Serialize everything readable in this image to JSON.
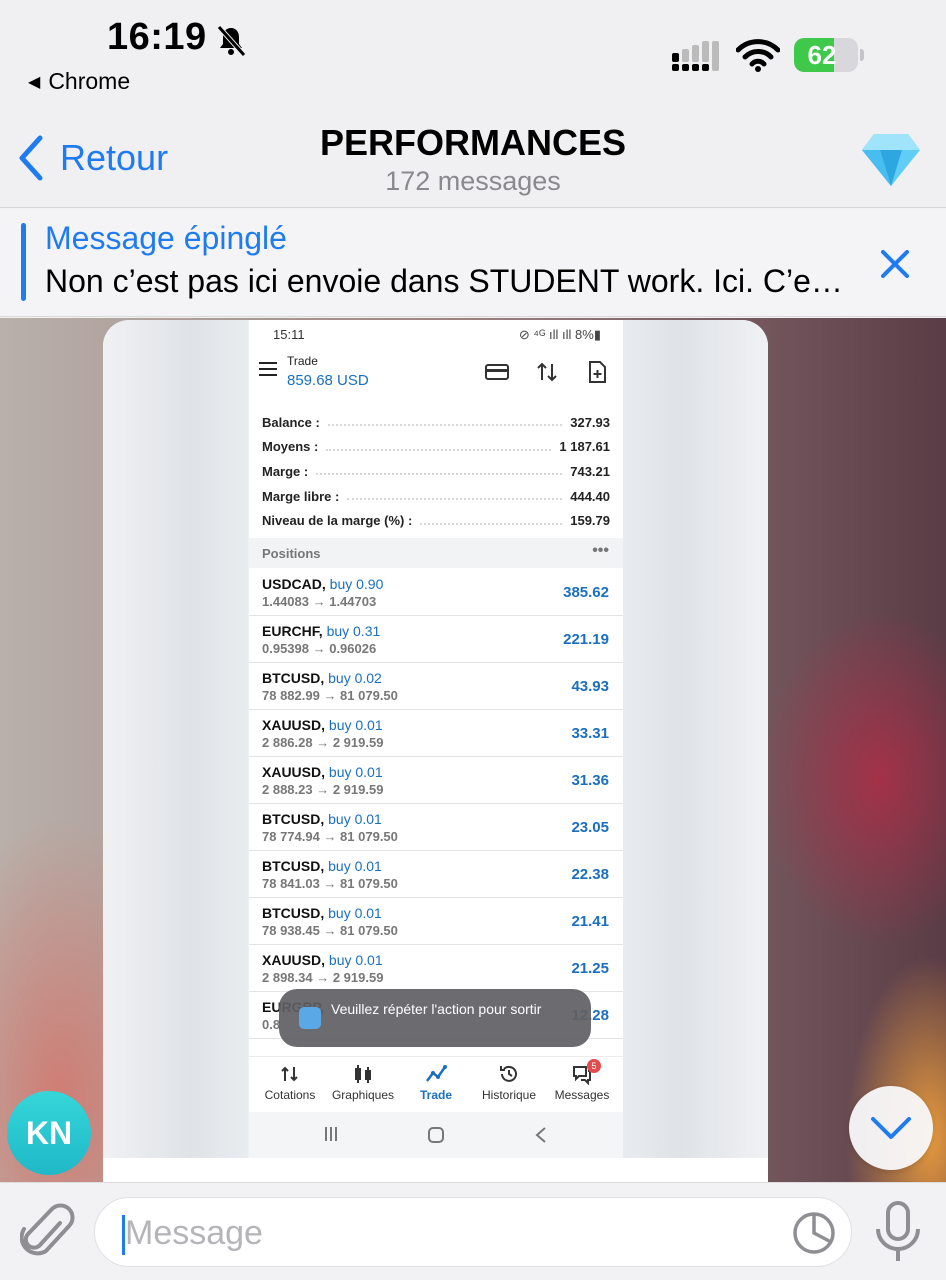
{
  "status_bar": {
    "time": "16:19",
    "back_app": "Chrome",
    "battery": "62",
    "battery_level": 0.62,
    "icons": [
      "bell-slash-icon",
      "signal-icon",
      "wifi-icon",
      "battery-charging-icon"
    ]
  },
  "header": {
    "back_label": "Retour",
    "title": "PERFORMANCES",
    "subtitle": "172 messages",
    "icons": [
      "chevron-left-icon",
      "diamond-icon"
    ]
  },
  "pinned": {
    "label": "Message épinglé",
    "text": "Non c’est pas ici envoie dans STUDENT work. Ici. C’e…"
  },
  "screenshot": {
    "status": {
      "time": "15:11",
      "right": "⊘ ⁴ᴳ ıll ıll 8%▮"
    },
    "header": {
      "title": "Trade",
      "balance": "859.68 USD"
    },
    "account": [
      {
        "label": "Balance :",
        "value": "327.93"
      },
      {
        "label": "Moyens :",
        "value": "1 187.61"
      },
      {
        "label": "Marge :",
        "value": "743.21"
      },
      {
        "label": "Marge libre :",
        "value": "444.40"
      },
      {
        "label": "Niveau de la marge (%) :",
        "value": "159.79"
      }
    ],
    "positions_title": "Positions",
    "positions_more": "•••",
    "positions": [
      {
        "symbol": "USDCAD,",
        "dir": "buy 0.90",
        "range": "1.44083 → 1.44703",
        "pl": "385.62"
      },
      {
        "symbol": "EURCHF,",
        "dir": "buy 0.31",
        "range": "0.95398 → 0.96026",
        "pl": "221.19"
      },
      {
        "symbol": "BTCUSD,",
        "dir": "buy 0.02",
        "range": "78 882.99 → 81 079.50",
        "pl": "43.93"
      },
      {
        "symbol": "XAUUSD,",
        "dir": "buy 0.01",
        "range": "2 886.28 → 2 919.59",
        "pl": "33.31"
      },
      {
        "symbol": "XAUUSD,",
        "dir": "buy 0.01",
        "range": "2 888.23 → 2 919.59",
        "pl": "31.36"
      },
      {
        "symbol": "BTCUSD,",
        "dir": "buy 0.01",
        "range": "78 774.94 → 81 079.50",
        "pl": "23.05"
      },
      {
        "symbol": "BTCUSD,",
        "dir": "buy 0.01",
        "range": "78 841.03 → 81 079.50",
        "pl": "22.38"
      },
      {
        "symbol": "BTCUSD,",
        "dir": "buy 0.01",
        "range": "78 938.45 → 81 079.50",
        "pl": "21.41"
      },
      {
        "symbol": "XAUUSD,",
        "dir": "buy 0.01",
        "range": "2 898.34 → 2 919.59",
        "pl": "21.25"
      },
      {
        "symbol": "EURGBP,",
        "dir": "",
        "range": "0.8",
        "pl": "12.28"
      }
    ],
    "toast": "Veuillez répéter l'action pour sortir",
    "tabs": [
      {
        "label": "Cotations",
        "icon": "quotes-icon"
      },
      {
        "label": "Graphiques",
        "icon": "candles-icon"
      },
      {
        "label": "Trade",
        "icon": "trade-icon",
        "active": true
      },
      {
        "label": "Historique",
        "icon": "history-icon"
      },
      {
        "label": "Messages",
        "icon": "messages-icon",
        "badge": "5"
      }
    ]
  },
  "avatar": {
    "initials": "KN"
  },
  "composer": {
    "placeholder": "Message",
    "icons": [
      "paperclip-icon",
      "sticker-icon",
      "microphone-icon"
    ]
  },
  "colors": {
    "accent": "#1f7cf0",
    "trade_blue": "#1a6fc0",
    "battery_green": "#3ec94a",
    "avatar": "#2cc8d2"
  }
}
